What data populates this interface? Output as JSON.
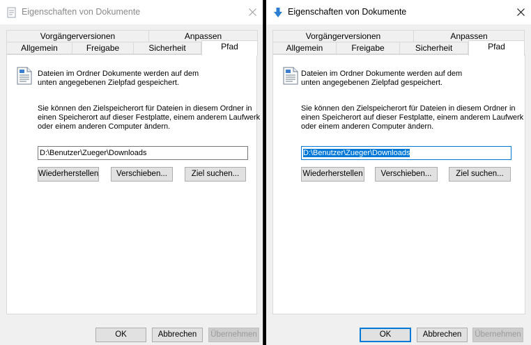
{
  "left": {
    "title": "Eigenschaften von Dokumente",
    "tabs_row1": [
      "Vorgängerversionen",
      "Anpassen"
    ],
    "tabs_row2": [
      "Allgemein",
      "Freigabe",
      "Sicherheit",
      "Pfad"
    ],
    "active_tab": "Pfad",
    "info_line1": "Dateien im Ordner Dokumente werden auf dem",
    "info_line2": "unten angegebenen Zielpfad gespeichert.",
    "desc_line1": "Sie können den Zielspeicherort für Dateien in diesem Ordner in",
    "desc_line2": "einen Speicherort auf dieser Festplatte, einem anderem Laufwerk",
    "desc_line3": "oder einem anderen Computer ändern.",
    "path_value": "D:\\Benutzer\\Zueger\\Downloads",
    "restore_label": "Wiederherstellen",
    "move_label": "Verschieben...",
    "find_label": "Ziel suchen...",
    "ok_label": "OK",
    "cancel_label": "Abbrechen",
    "apply_label": "Übernehmen",
    "active_window": false
  },
  "right": {
    "title": "Eigenschaften von Dokumente",
    "tabs_row1": [
      "Vorgängerversionen",
      "Anpassen"
    ],
    "tabs_row2": [
      "Allgemein",
      "Freigabe",
      "Sicherheit",
      "Pfad"
    ],
    "active_tab": "Pfad",
    "info_line1": "Dateien im Ordner Dokumente werden auf dem",
    "info_line2": "unten angegebenen Zielpfad gespeichert.",
    "desc_line1": "Sie können den Zielspeicherort für Dateien in diesem Ordner in",
    "desc_line2": "einen Speicherort auf dieser Festplatte, einem anderem Laufwerk",
    "desc_line3": "oder einem anderen Computer ändern.",
    "path_value": "D:\\Benutzer\\Zueger\\Downloads",
    "restore_label": "Wiederherstellen",
    "move_label": "Verschieben...",
    "find_label": "Ziel suchen...",
    "ok_label": "OK",
    "cancel_label": "Abbrechen",
    "apply_label": "Übernehmen",
    "active_window": true
  },
  "colors": {
    "accent": "#0078d7",
    "window_bg": "#f0f0f0",
    "disabled_text": "#9a9a9a"
  }
}
